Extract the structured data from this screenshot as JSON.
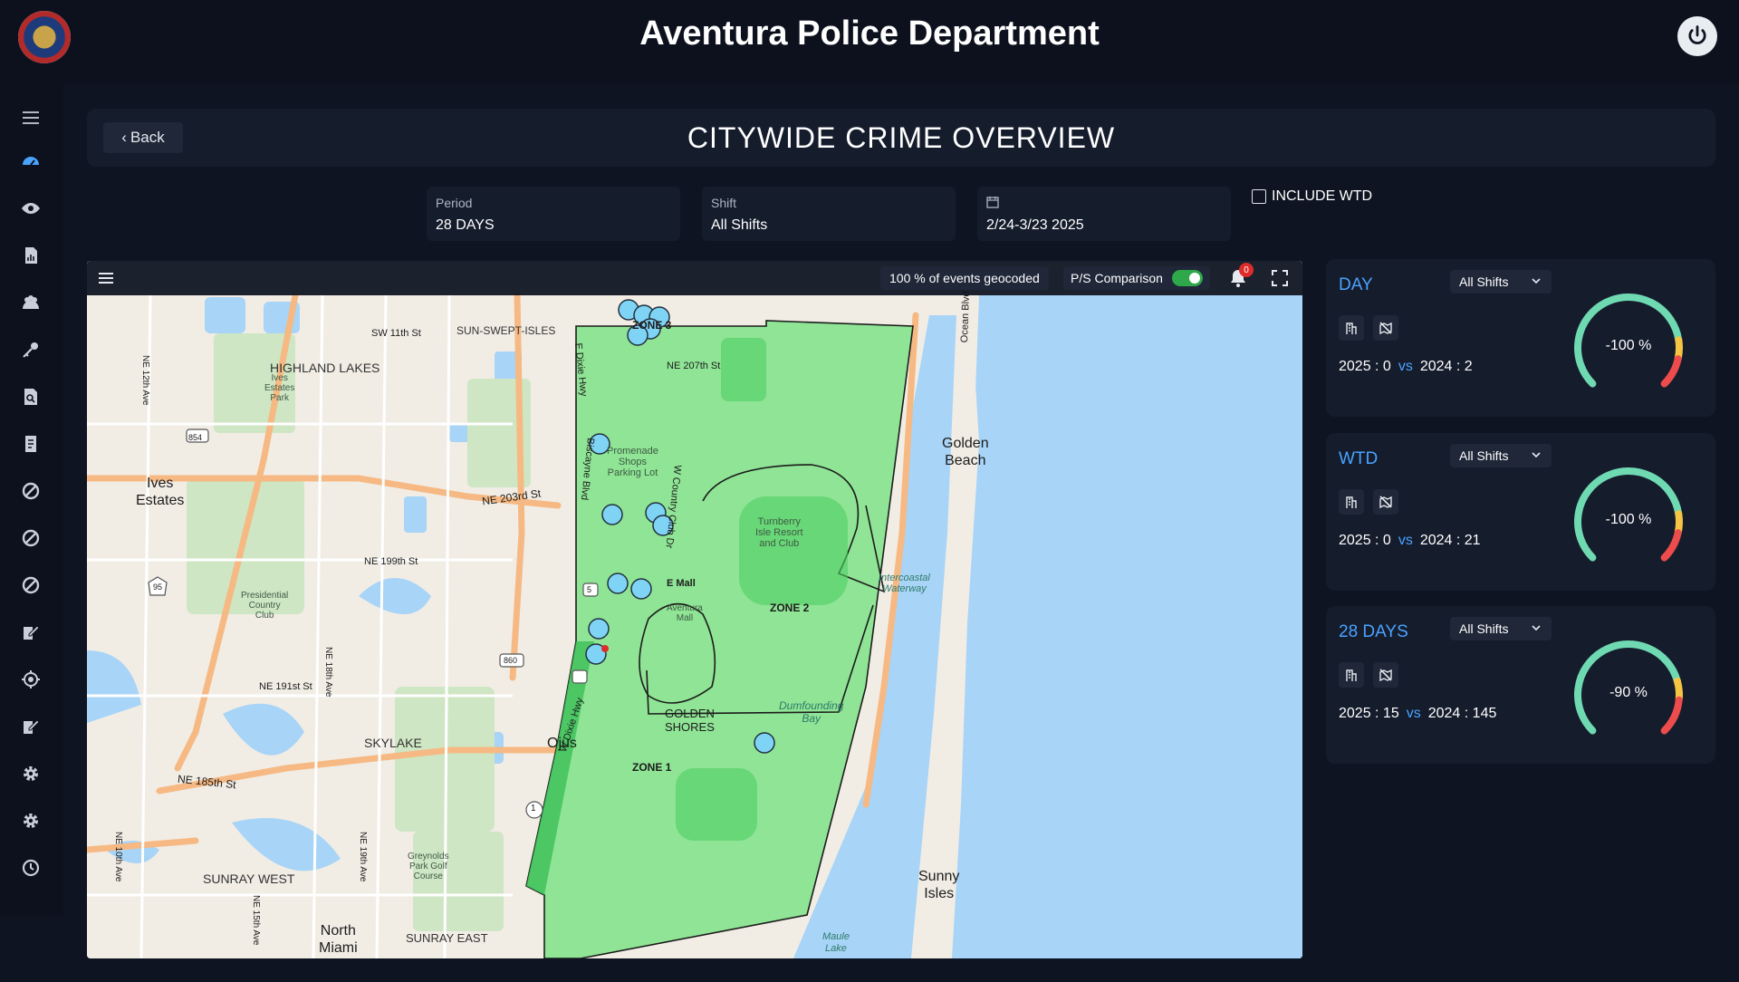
{
  "header": {
    "title": "Aventura Police Department",
    "logo_icon": "police-badge-icon",
    "power_icon": "power-icon"
  },
  "sidebar": {
    "items": [
      {
        "icon": "menu-icon"
      },
      {
        "icon": "dashboard-icon"
      },
      {
        "icon": "eye-icon"
      },
      {
        "icon": "report-icon"
      },
      {
        "icon": "users-icon"
      },
      {
        "icon": "key-icon"
      },
      {
        "icon": "search-report-icon"
      },
      {
        "icon": "document-icon"
      },
      {
        "icon": "block-icon"
      },
      {
        "icon": "block-icon"
      },
      {
        "icon": "block-icon"
      },
      {
        "icon": "edit-icon"
      },
      {
        "icon": "target-icon"
      },
      {
        "icon": "edit-icon"
      },
      {
        "icon": "gear-icon"
      },
      {
        "icon": "gear-icon"
      },
      {
        "icon": "history-icon"
      }
    ]
  },
  "page": {
    "back_label": "Back",
    "title": "CITYWIDE CRIME OVERVIEW"
  },
  "filters": {
    "period": {
      "label": "Period",
      "value": "28 DAYS"
    },
    "shift": {
      "label": "Shift",
      "value": "All Shifts"
    },
    "date": {
      "value": "2/24-3/23 2025",
      "icon": "calendar-icon"
    },
    "include_wtd": {
      "label": "INCLUDE WTD",
      "checked": false
    }
  },
  "map": {
    "geocoded": "100 % of events geocoded",
    "ps_comparison": {
      "label": "P/S Comparison",
      "on": true
    },
    "notifications": "0",
    "labels": {
      "zone1": "ZONE 1",
      "zone2": "ZONE 2",
      "zone3": "ZONE 3",
      "golden_shores": "GOLDEN",
      "golden_shores2": "SHORES",
      "golden_beach": "Golden",
      "golden_beach2": "Beach",
      "sunny_isles": "Sunny",
      "sunny_isles2": "Isles",
      "ives_estates": "Ives",
      "ives_estates2": "Estates",
      "highland_lakes": "HIGHLAND LAKES",
      "skylake": "SKYLAKE",
      "sunray_west": "SUNRAY WEST",
      "sunray_east": "SUNRAY EAST",
      "north_miami": "North",
      "north_miami2": "Miami",
      "ojus": "Ojus",
      "ne_203rd": "NE 203rd St",
      "ne_199th": "NE 199th St",
      "ne_207th": "NE 207th St",
      "ne_191st": "NE 191st St",
      "ne_185th": "NE 185th St",
      "sw_11th": "SW 11th St",
      "sun_swept": "SUN-SWEPT-ISLES",
      "dumfounding": "Dumfounding",
      "dumfounding2": "Bay",
      "turnberry": "Turnberry",
      "turnberry2": "Isle Resort",
      "turnberry3": "and Club",
      "aventura_mall": "Aventura",
      "aventura_mall2": "Mall",
      "promenade": "Promenade",
      "promenade2": "Shops",
      "promenade3": "Parking Lot",
      "presidential": "Presidential",
      "presidential2": "Country",
      "presidential3": "Club",
      "greynolds": "Greynolds",
      "greynolds2": "Park Golf",
      "greynolds3": "Course",
      "ives_park": "Ives",
      "ives_park2": "Estates",
      "ives_park3": "Park",
      "intercoastal": "Intercoastal",
      "intercoastal2": "Waterway",
      "maule": "Maule",
      "maule2": "Lake",
      "ocean_blvd": "Ocean Blvd",
      "e_dixie": "E Dixie Hwy",
      "w_dixie": "W Dixie Hwy",
      "biscayne": "Biscayne Blvd",
      "country_club": "W Country Club Dr",
      "ne_12th": "NE 12th Ave",
      "ne_18th": "NE 18th Ave",
      "ne_19th": "NE 19th Ave",
      "ne_10th": "NE 10th Ave",
      "ne_15th": "NE 15th Ave",
      "rt_854": "854",
      "rt_860": "860",
      "rt_95": "95",
      "rt_1": "1",
      "rt_5": "5",
      "ne_mall": "E Mall"
    }
  },
  "cards": [
    {
      "title": "DAY",
      "shift": "All Shifts",
      "current": "2025 : 0",
      "vs": "vs",
      "previous": "2024 : 2",
      "change": "-100 %",
      "change_pct": -100
    },
    {
      "title": "WTD",
      "shift": "All Shifts",
      "current": "2025 : 0",
      "vs": "vs",
      "previous": "2024 : 21",
      "change": "-100 %",
      "change_pct": -100
    },
    {
      "title": "28 DAYS",
      "shift": "All Shifts",
      "current": "2025 : 15",
      "vs": "vs",
      "previous": "2024 : 145",
      "change": "-90 %",
      "change_pct": -90
    }
  ],
  "colors": {
    "accent": "#4aa3ff",
    "zone_fill": "#6ee07a",
    "water": "#a8d4f7",
    "gauge_green": "#6fd9b2",
    "gauge_yellow": "#f4c542",
    "gauge_red": "#ec4c4c"
  }
}
